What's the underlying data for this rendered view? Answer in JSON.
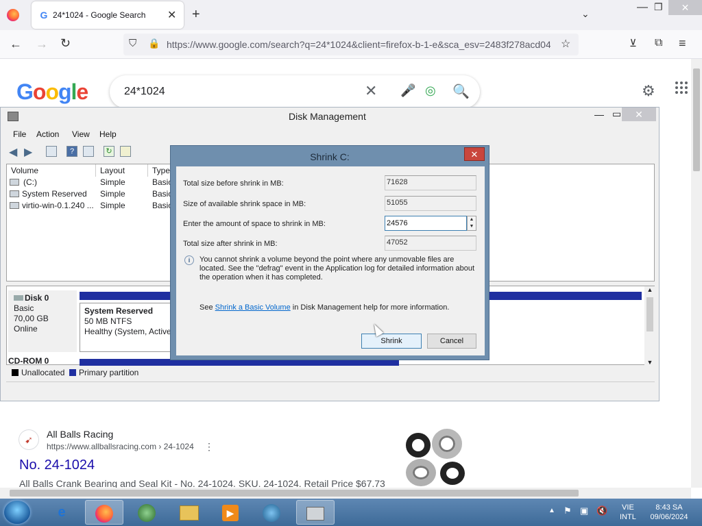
{
  "browser": {
    "tab_title": "24*1024 - Google Search",
    "tab_favicon": "G",
    "url": "https://www.google.com/search?q=24*1024&client=firefox-b-1-e&sca_esv=2483f278acd04",
    "icons": {
      "back": "←",
      "forward": "→",
      "reload": "↻",
      "shield": "⛉",
      "lock": "🔒",
      "star": "☆",
      "pocket": "⊻",
      "extensions": "⧉",
      "menu": "≡",
      "new_tab": "+",
      "close_tab": "✕",
      "tab_list": "⌄",
      "minimize": "—",
      "restore": "❐",
      "close": "✕"
    }
  },
  "google": {
    "logo": "Google",
    "query": "24*1024",
    "icons": {
      "clear": "✕",
      "mic": "🎤",
      "lens": "◎",
      "search": "🔍",
      "settings": "⚙",
      "apps": "⋮⋮⋮"
    }
  },
  "result": {
    "site_name": "All Balls Racing",
    "url": "https://www.allballsracing.com › 24-1024",
    "more": "⋮",
    "title": "No. 24-1024",
    "snippet": "All Balls Crank Bearing and Seal Kit - No. 24-1024. SKU. 24-1024. Retail Price $67.73"
  },
  "disk_management": {
    "title": "Disk Management",
    "menu": [
      "File",
      "Action",
      "View",
      "Help"
    ],
    "columns": [
      "Volume",
      "Layout",
      "Type"
    ],
    "volumes": [
      {
        "name": "(C:)",
        "layout": "Simple",
        "type": "Basic"
      },
      {
        "name": "System Reserved",
        "layout": "Simple",
        "type": "Basic"
      },
      {
        "name": "virtio-win-0.1.240 ...",
        "layout": "Simple",
        "type": "Basic"
      }
    ],
    "disk0": {
      "name": "Disk 0",
      "type": "Basic",
      "size": "70,00 GB",
      "status": "Online"
    },
    "system_reserved": {
      "name": "System Reserved",
      "size": "50 MB NTFS",
      "status": "Healthy (System, Active,"
    },
    "cdrom": "CD-ROM 0",
    "legend": {
      "unallocated": "Unallocated",
      "primary": "Primary partition",
      "unallocated_color": "#000000",
      "primary_color": "#1f2fa0"
    }
  },
  "dialog": {
    "title": "Shrink C:",
    "total_before_label": "Total size before shrink in MB:",
    "total_before": "71628",
    "available_label": "Size of available shrink space in MB:",
    "available": "51055",
    "amount_label": "Enter the amount of space to shrink in MB:",
    "amount": "24576",
    "total_after_label": "Total size after shrink in MB:",
    "total_after": "47052",
    "info": "You cannot shrink a volume beyond the point where any unmovable files are located. See the \"defrag\" event in the Application log for detailed information about the operation when it has completed.",
    "help_prefix": "See ",
    "help_link": "Shrink a Basic Volume",
    "help_suffix": " in Disk Management help for more information.",
    "shrink_button": "Shrink",
    "cancel_button": "Cancel"
  },
  "taskbar": {
    "language": [
      "VIE",
      "INTL"
    ],
    "time": "8:43 SA",
    "date": "09/06/2024"
  }
}
